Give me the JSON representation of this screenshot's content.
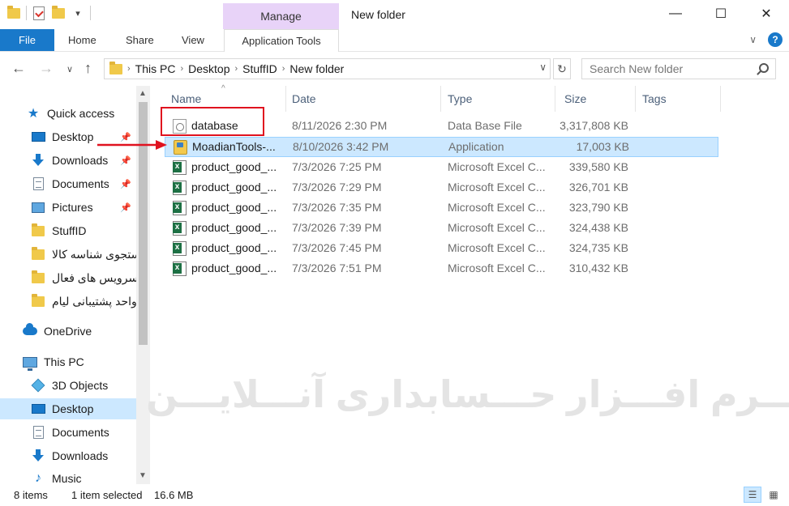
{
  "titlebar": {
    "manage_label": "Manage",
    "window_title": "New folder",
    "minimize": "—",
    "maximize": "☐",
    "close": "✕"
  },
  "ribbon": {
    "tabs": [
      "File",
      "Home",
      "Share",
      "View",
      "Application Tools"
    ],
    "expand": "∨",
    "help": "?"
  },
  "address": {
    "back": "←",
    "forward": "→",
    "recent": "∨",
    "up": "↑",
    "crumbs": [
      "This PC",
      "Desktop",
      "StuffID",
      "New folder"
    ],
    "refresh": "↻",
    "search_placeholder": "Search New folder"
  },
  "nav": {
    "items": [
      {
        "label": "Quick access",
        "icon": "star-icon"
      },
      {
        "label": "Desktop",
        "icon": "desktop-icon",
        "pinned": true
      },
      {
        "label": "Downloads",
        "icon": "downloads-icon",
        "pinned": true
      },
      {
        "label": "Documents",
        "icon": "documents-icon",
        "pinned": true
      },
      {
        "label": "Pictures",
        "icon": "pictures-icon",
        "pinned": true
      },
      {
        "label": "StuffID",
        "icon": "folder-icon"
      },
      {
        "label": "جستجوی شناسه کالا",
        "icon": "folder-icon"
      },
      {
        "label": "سرویس های فعال",
        "icon": "folder-icon"
      },
      {
        "label": "واحد پشتیبانی لیام",
        "icon": "folder-icon"
      },
      {
        "label": "OneDrive",
        "icon": "onedrive-icon"
      },
      {
        "label": "This PC",
        "icon": "this-pc-icon"
      },
      {
        "label": "3D Objects",
        "icon": "3d-objects-icon"
      },
      {
        "label": "Desktop",
        "icon": "desktop-icon",
        "selected": true
      },
      {
        "label": "Documents",
        "icon": "documents-icon"
      },
      {
        "label": "Downloads",
        "icon": "downloads-icon"
      },
      {
        "label": "Music",
        "icon": "music-icon"
      }
    ],
    "pin_glyph": "📌"
  },
  "columns": [
    "Name",
    "Date",
    "Type",
    "Size",
    "Tags"
  ],
  "files": [
    {
      "name": "database",
      "date": "8/11/2026 2:30 PM",
      "type": "Data Base File",
      "size": "3,317,808 KB",
      "icon": "database-file-icon"
    },
    {
      "name": "MoadianTools-...",
      "date": "8/10/2026 3:42 PM",
      "type": "Application",
      "size": "17,003 KB",
      "icon": "application-icon",
      "selected": true
    },
    {
      "name": "product_good_...",
      "date": "7/3/2026 7:25 PM",
      "type": "Microsoft Excel C...",
      "size": "339,580 KB",
      "icon": "excel-icon"
    },
    {
      "name": "product_good_...",
      "date": "7/3/2026 7:29 PM",
      "type": "Microsoft Excel C...",
      "size": "326,701 KB",
      "icon": "excel-icon"
    },
    {
      "name": "product_good_...",
      "date": "7/3/2026 7:35 PM",
      "type": "Microsoft Excel C...",
      "size": "323,790 KB",
      "icon": "excel-icon"
    },
    {
      "name": "product_good_...",
      "date": "7/3/2026 7:39 PM",
      "type": "Microsoft Excel C...",
      "size": "324,438 KB",
      "icon": "excel-icon"
    },
    {
      "name": "product_good_...",
      "date": "7/3/2026 7:45 PM",
      "type": "Microsoft Excel C...",
      "size": "324,735 KB",
      "icon": "excel-icon"
    },
    {
      "name": "product_good_...",
      "date": "7/3/2026 7:51 PM",
      "type": "Microsoft Excel C...",
      "size": "310,432 KB",
      "icon": "excel-icon"
    }
  ],
  "watermark": "نـــرم افـــزار حـــسابداری آنـــلایـــن",
  "status": {
    "items": "8 items",
    "selected": "1 item selected",
    "size": "16.6 MB"
  },
  "colors": {
    "accent": "#1979ca",
    "manage_tab": "#e8d3f8",
    "selection": "#cce8ff",
    "annotation_red": "#e0121f"
  }
}
